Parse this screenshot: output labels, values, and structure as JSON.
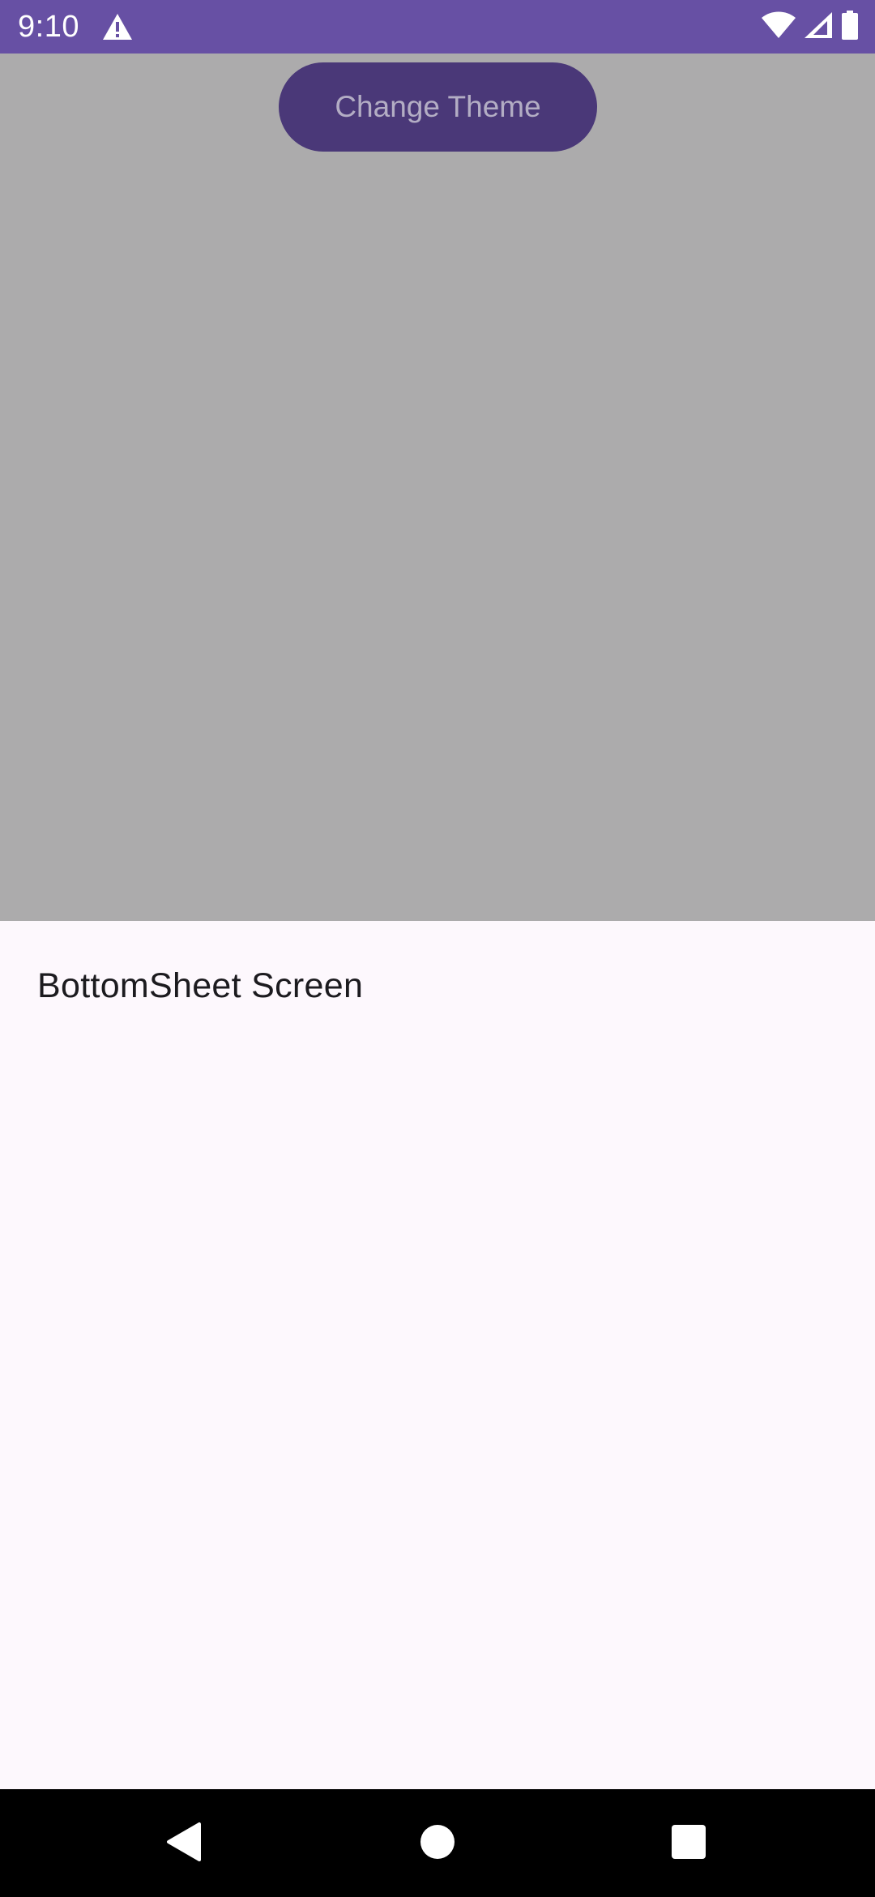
{
  "status_bar": {
    "time": "9:10",
    "background_color": "#6750a4",
    "icons": [
      "warning-icon",
      "wifi-icon",
      "signal-icon",
      "battery-icon"
    ]
  },
  "main": {
    "change_theme_label": "Change Theme",
    "scrim_color": "#acabac",
    "button_color": "#4a3878"
  },
  "bottom_sheet": {
    "title": "BottomSheet Screen",
    "background_color": "#fdf8fd"
  },
  "nav_bar": {
    "buttons": [
      "back-icon",
      "home-icon",
      "recents-icon"
    ]
  }
}
